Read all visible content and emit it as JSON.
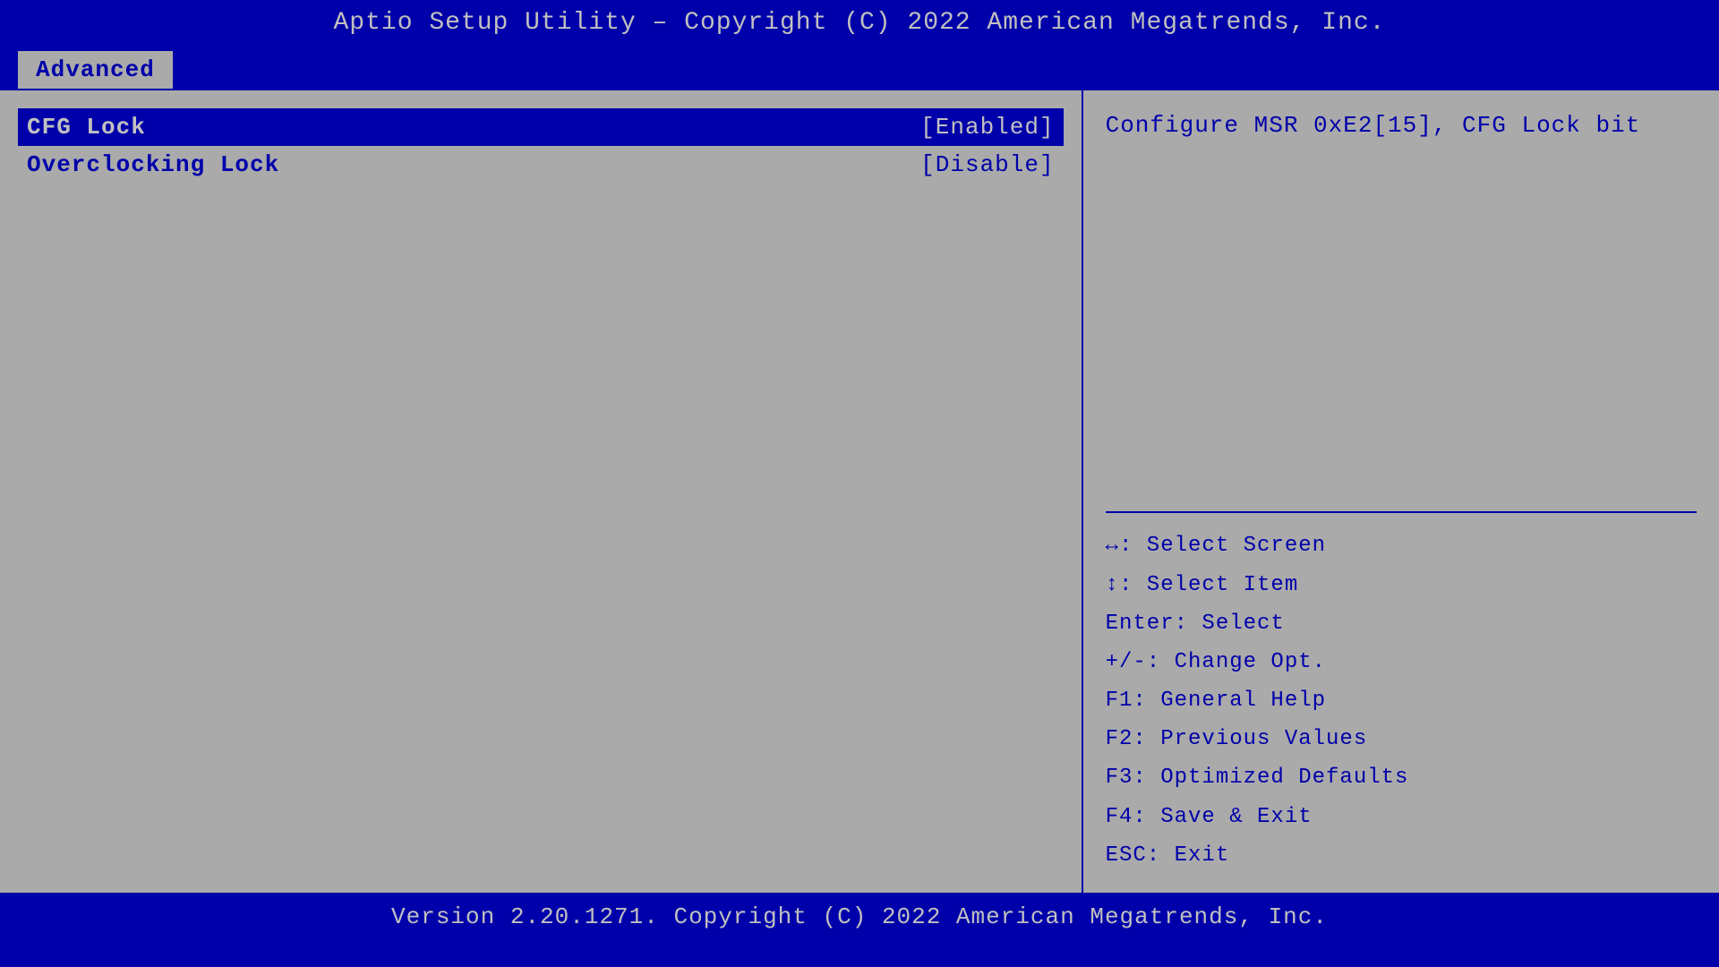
{
  "header": {
    "title": "Aptio Setup Utility – Copyright (C) 2022 American Megatrends, Inc."
  },
  "tab": {
    "label": "Advanced"
  },
  "settings": [
    {
      "name": "CFG Lock",
      "value": "[Enabled]",
      "highlighted": true
    },
    {
      "name": "Overclocking Lock",
      "value": "[Disable]",
      "highlighted": false
    }
  ],
  "help": {
    "text": "Configure MSR 0xE2[15], CFG Lock bit"
  },
  "keyhints": [
    "↔: Select Screen",
    "↕: Select Item",
    "Enter: Select",
    "+/-: Change Opt.",
    "F1: General Help",
    "F2: Previous Values",
    "F3: Optimized Defaults",
    "F4: Save & Exit",
    "ESC: Exit"
  ],
  "footer": {
    "text": "Version 2.20.1271. Copyright (C) 2022 American Megatrends, Inc."
  }
}
